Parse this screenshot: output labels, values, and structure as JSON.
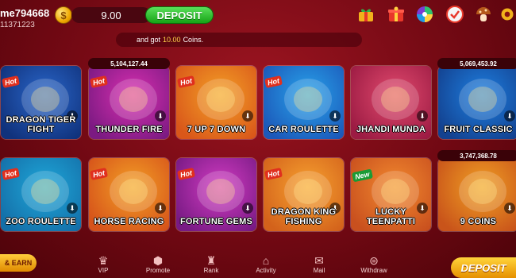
{
  "user": {
    "name": "me794668",
    "id": "11371223",
    "balance": "9.00",
    "coin_symbol": "$"
  },
  "header": {
    "deposit_label": "DEPOSIT",
    "icons": [
      "gift-icon",
      "present-box-icon",
      "wheel-icon",
      "bonus-icon",
      "mushroom-icon",
      "settings-icon"
    ]
  },
  "marquee": {
    "text_before": "and got",
    "amount": "10.00",
    "text_after": "Coins."
  },
  "games": [
    {
      "name": "DRAGON TIGER FIGHT",
      "badge": "Hot",
      "color_a": "#2a66c9",
      "color_b": "#10327c",
      "jackpot": ""
    },
    {
      "name": "THUNDER FIRE",
      "badge": "Hot",
      "color_a": "#d92fb0",
      "color_b": "#7b1a82",
      "jackpot": "5,104,127.44"
    },
    {
      "name": "7 UP 7 DOWN",
      "badge": "Hot",
      "color_a": "#f3a026",
      "color_b": "#d9571a",
      "jackpot": ""
    },
    {
      "name": "CAR ROULETTE",
      "badge": "Hot",
      "color_a": "#28a3ea",
      "color_b": "#1c58b9",
      "jackpot": ""
    },
    {
      "name": "JHANDI MUNDA",
      "badge": "",
      "color_a": "#e14a6e",
      "color_b": "#9c1b43",
      "jackpot": ""
    },
    {
      "name": "FRUIT CLASSIC",
      "badge": "",
      "color_a": "#1e7fe0",
      "color_b": "#13418f",
      "jackpot": "5,069,453.92"
    },
    {
      "name": "ZOO ROULETTE",
      "badge": "Hot",
      "color_a": "#1fa7d9",
      "color_b": "#146fa8",
      "jackpot": ""
    },
    {
      "name": "HORSE RACING",
      "badge": "Hot",
      "color_a": "#f3a026",
      "color_b": "#d6531a",
      "jackpot": ""
    },
    {
      "name": "FORTUNE GEMS",
      "badge": "Hot",
      "color_a": "#d23cc2",
      "color_b": "#781a84",
      "jackpot": ""
    },
    {
      "name": "DRAGON KING FISHING",
      "badge": "Hot",
      "color_a": "#f7a230",
      "color_b": "#d3621b",
      "jackpot": ""
    },
    {
      "name": "LUCKY TEENPATTI",
      "badge": "New",
      "color_a": "#f28a2f",
      "color_b": "#c9501e",
      "jackpot": ""
    },
    {
      "name": "9 COINS",
      "badge": "",
      "color_a": "#f0a024",
      "color_b": "#c9541a",
      "jackpot": "3,747,368.78"
    }
  ],
  "bottom_nav": {
    "earn_label": "& EARN",
    "items": [
      {
        "label": "VIP",
        "icon": "vip-icon"
      },
      {
        "label": "Promote",
        "icon": "promote-icon"
      },
      {
        "label": "Rank",
        "icon": "trophy-icon"
      },
      {
        "label": "Activity",
        "icon": "activity-icon"
      },
      {
        "label": "Mail",
        "icon": "mail-icon"
      },
      {
        "label": "Withdraw",
        "icon": "withdraw-icon"
      }
    ],
    "deposit_label": "DEPOSIT"
  }
}
